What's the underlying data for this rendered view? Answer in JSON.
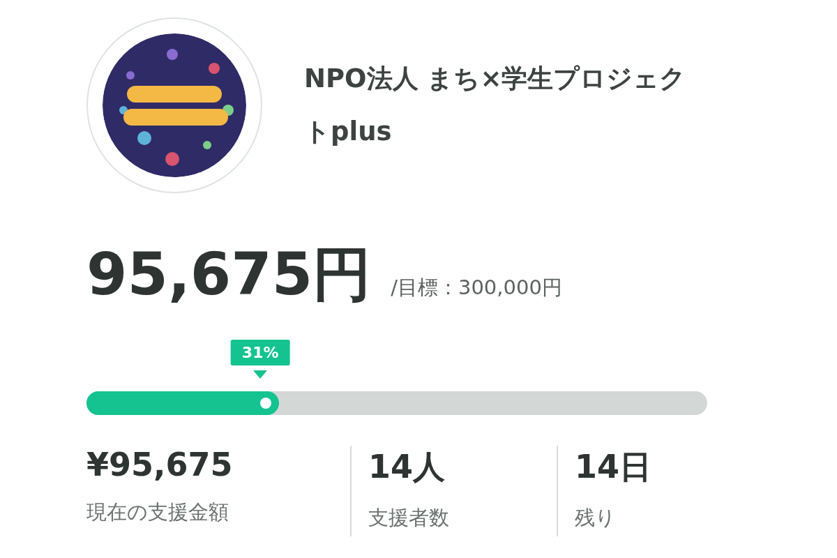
{
  "organization": {
    "name": "NPO法人 まち×学生プロジェクトplus"
  },
  "funding": {
    "amount": "95,675円",
    "goal": "/目標：300,000円",
    "percent": "31%",
    "level": 0.31
  },
  "stats": [
    {
      "value": "¥95,675",
      "label": "現在の支援金額"
    },
    {
      "value": "14人",
      "label": "支援者数"
    },
    {
      "value": "14日",
      "label": "残り"
    }
  ]
}
